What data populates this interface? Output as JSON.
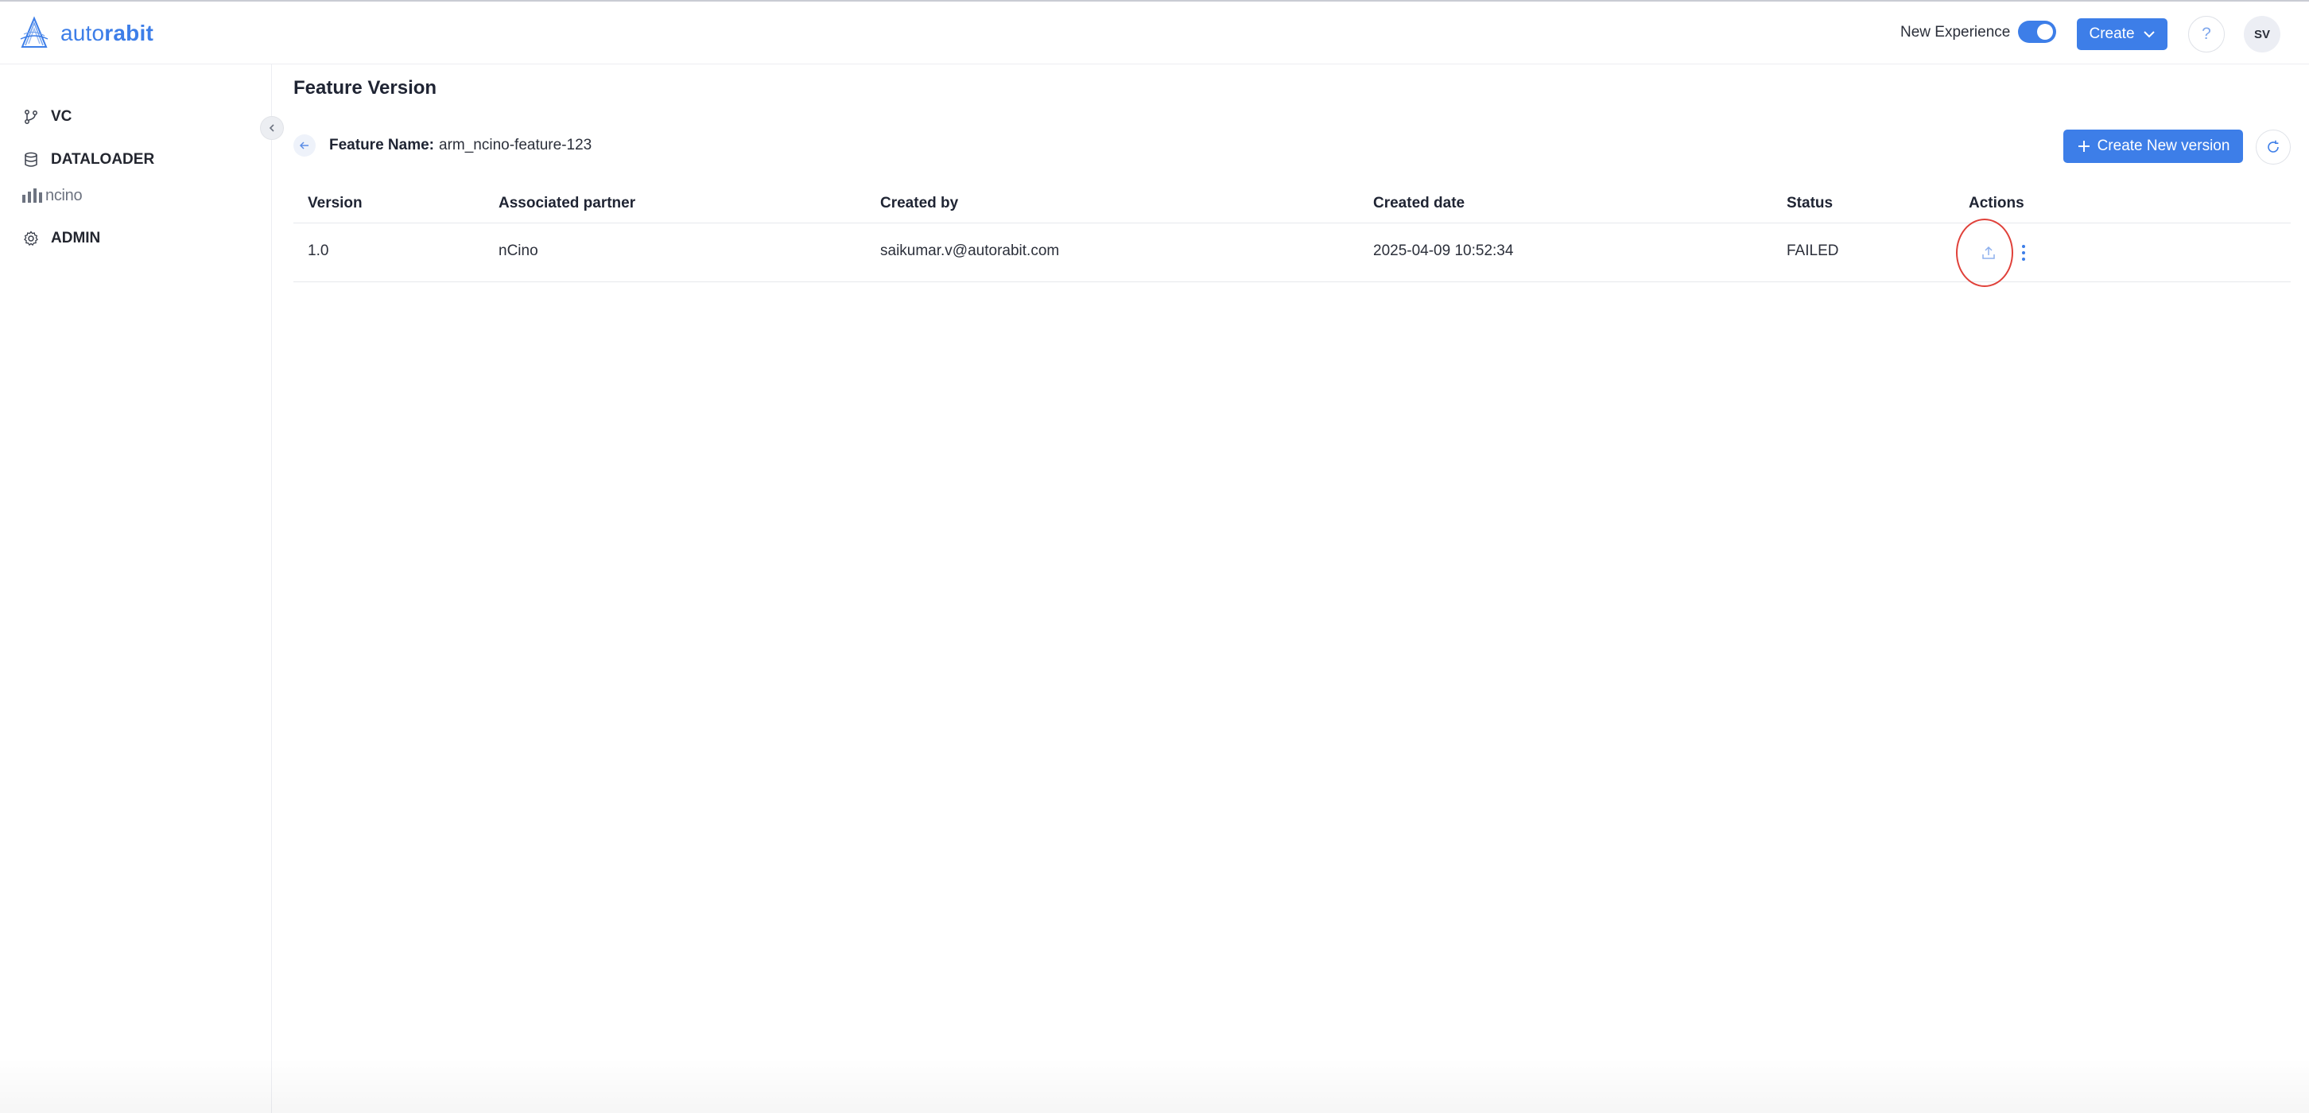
{
  "app": {
    "logo_text_light": "auto",
    "logo_text_bold": "rabit",
    "brand_color": "#3d7ee8"
  },
  "header": {
    "new_experience_label": "New Experience",
    "new_experience_on": true,
    "create_label": "Create",
    "help_label": "?",
    "avatar_initials": "SV"
  },
  "sidebar": {
    "items": [
      {
        "label": "VC",
        "icon": "git-branch-icon"
      },
      {
        "label": "DATALOADER",
        "icon": "database-icon"
      },
      {
        "label": "ncino",
        "icon": "ncino-logo"
      },
      {
        "label": "ADMIN",
        "icon": "gear-icon"
      }
    ]
  },
  "main": {
    "title": "Feature Version",
    "feature_label": "Feature Name:",
    "feature_value": "arm_ncino-feature-123",
    "create_version_label": "Create New version",
    "table": {
      "columns": [
        "Version",
        "Associated partner",
        "Created by",
        "Created date",
        "Status",
        "Actions"
      ],
      "rows": [
        {
          "version": "1.0",
          "partner": "nCino",
          "created_by": "saikumar.v@autorabit.com",
          "created_date": "2025-04-09 10:52:34",
          "status": "FAILED"
        }
      ]
    }
  },
  "colors": {
    "primary": "#3d7ee8",
    "highlight_ring": "#e0413a"
  }
}
